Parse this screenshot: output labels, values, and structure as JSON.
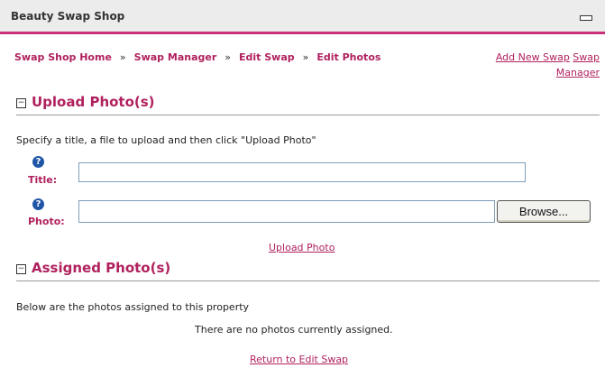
{
  "window": {
    "title": "Beauty Swap Shop"
  },
  "breadcrumb": {
    "items": [
      "Swap Shop Home",
      "Swap Manager",
      "Edit Swap",
      "Edit Photos"
    ],
    "separator": "»"
  },
  "top_links": {
    "add_new_swap": "Add New Swap",
    "swap_manager": "Swap Manager"
  },
  "upload_section": {
    "toggle": "−",
    "title": "Upload Photo(s)",
    "description": "Specify a title, a file to upload and then click \"Upload Photo\"",
    "title_label": "Title:",
    "title_value": "",
    "photo_label": "Photo:",
    "photo_value": "",
    "browse_label": "Browse...",
    "upload_link": "Upload Photo",
    "help_glyph": "?"
  },
  "assigned_section": {
    "toggle": "−",
    "title": "Assigned Photo(s)",
    "description": "Below are the photos assigned to this property",
    "empty_message": "There are no photos currently assigned."
  },
  "return_link": "Return to Edit Swap",
  "colors": {
    "accent": "#b0215e",
    "bar_border": "#cc2f79",
    "help_icon": "#1f56a8"
  }
}
